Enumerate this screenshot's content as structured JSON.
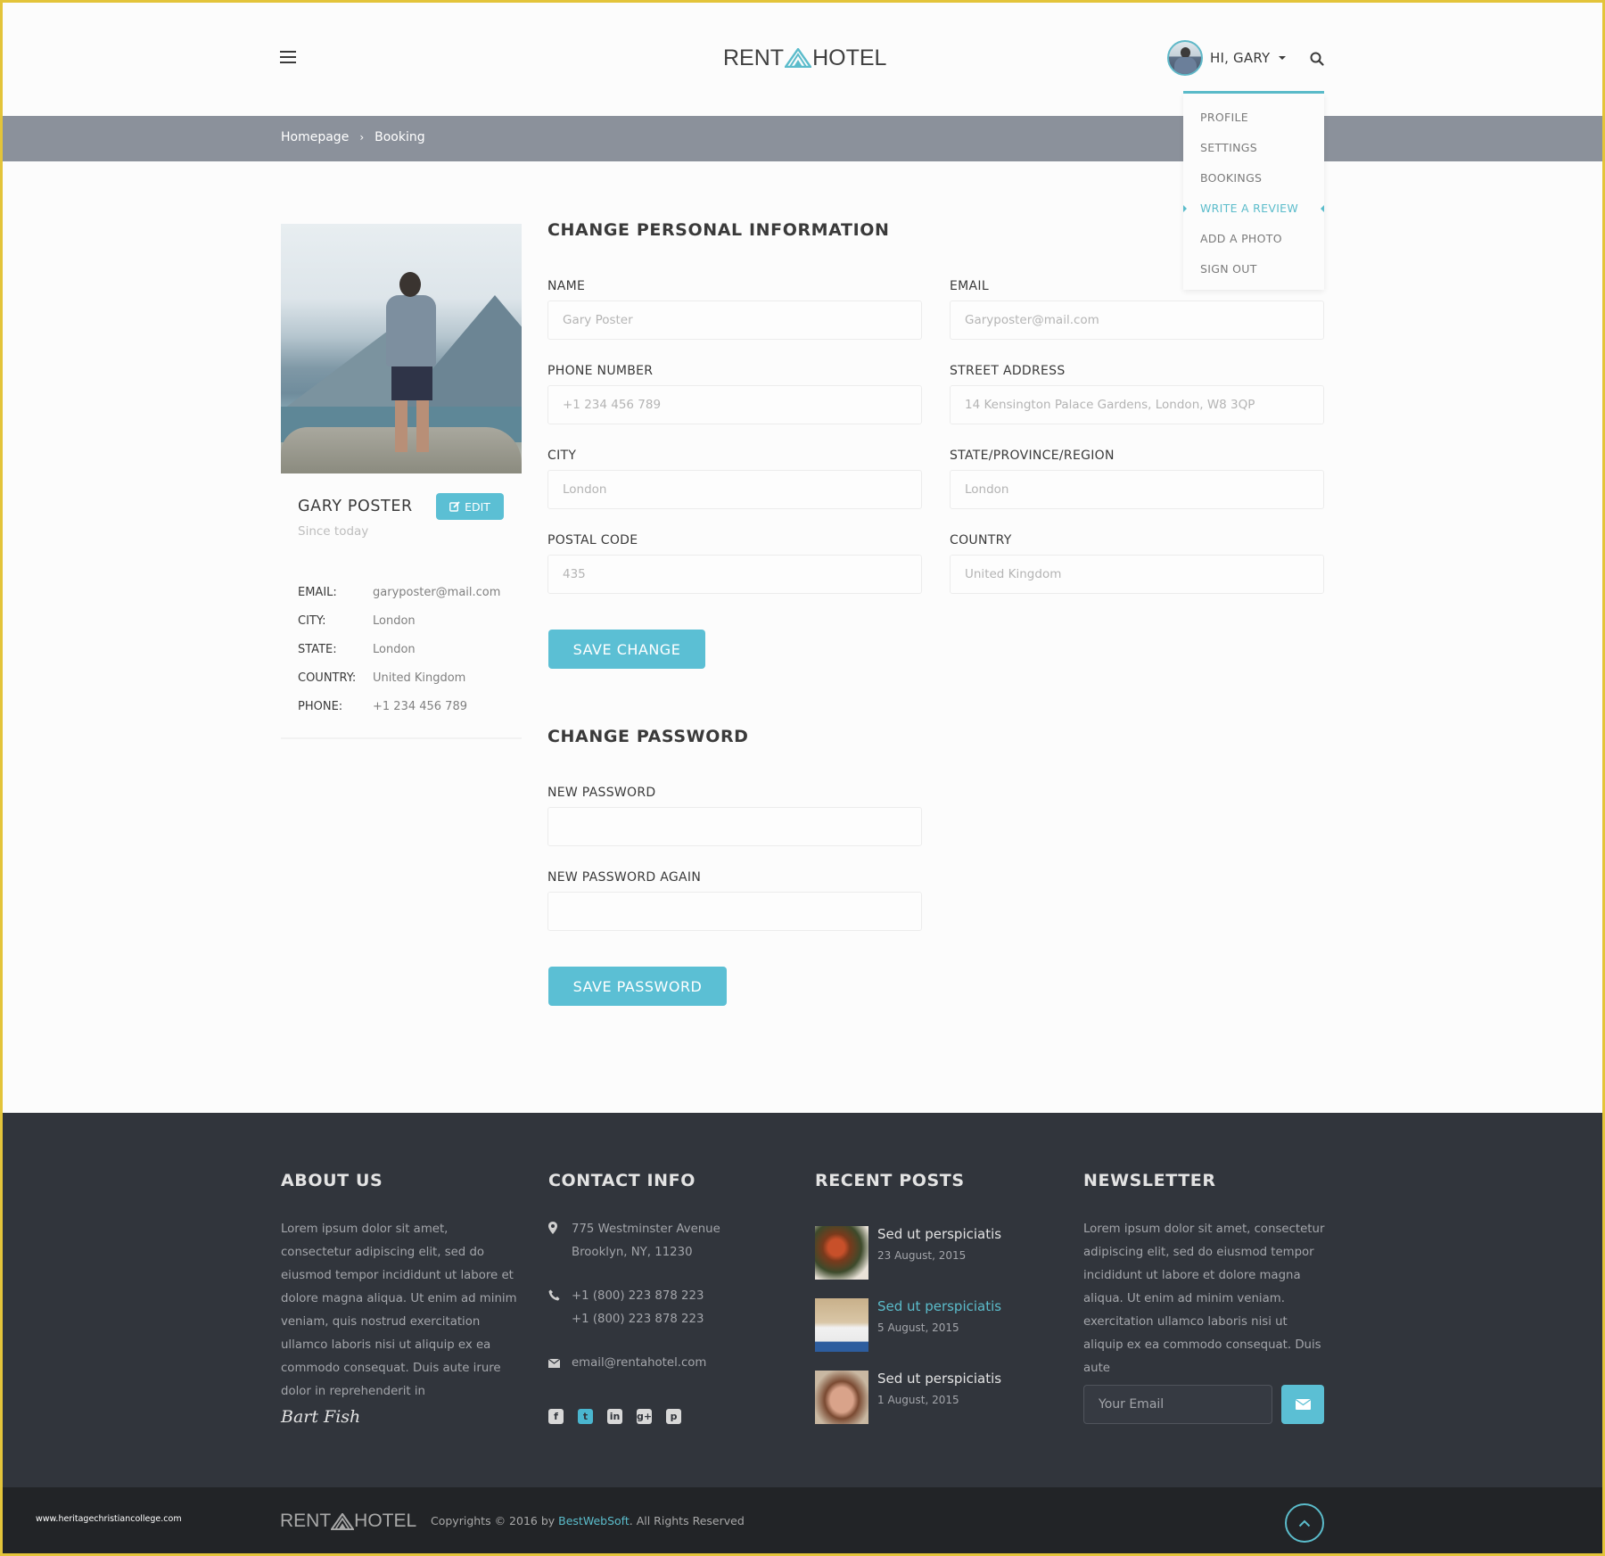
{
  "header": {
    "logo_left": "RENT",
    "logo_right": "HOTEL",
    "greeting": "HI, GARY",
    "icons": {
      "menu": "hamburger-icon",
      "search": "search-icon",
      "caret": "caret-down-icon"
    }
  },
  "user_dropdown": {
    "items": [
      {
        "label": "PROFILE",
        "active": false
      },
      {
        "label": "SETTINGS",
        "active": false
      },
      {
        "label": "BOOKINGS",
        "active": false
      },
      {
        "label": "WRITE A REVIEW",
        "active": true
      },
      {
        "label": "ADD A PHOTO",
        "active": false
      },
      {
        "label": "SIGN OUT",
        "active": false
      }
    ]
  },
  "breadcrumb": {
    "items": [
      "Homepage",
      "Booking"
    ],
    "separator": "›"
  },
  "profile": {
    "name": "GARY POSTER",
    "edit_label": "EDIT",
    "since": "Since today",
    "details": [
      {
        "key": "EMAIL:",
        "value": "garyposter@mail.com"
      },
      {
        "key": "CITY:",
        "value": "London"
      },
      {
        "key": "STATE:",
        "value": "London"
      },
      {
        "key": "COUNTRY:",
        "value": "United Kingdom"
      },
      {
        "key": "PHONE:",
        "value": "+1 234 456 789"
      }
    ]
  },
  "personal_form": {
    "title": "CHANGE PERSONAL INFORMATION",
    "fields": {
      "name": {
        "label": "NAME",
        "placeholder": "Gary Poster"
      },
      "email": {
        "label": "EMAIL",
        "placeholder": "Garyposter@mail.com"
      },
      "phone": {
        "label": "PHONE NUMBER",
        "placeholder": "+1 234 456 789"
      },
      "street": {
        "label": "STREET ADDRESS",
        "placeholder": "14 Kensington Palace Gardens, London, W8 3QP"
      },
      "city": {
        "label": "CITY",
        "placeholder": "London"
      },
      "state": {
        "label": "STATE/PROVINCE/REGION",
        "placeholder": "London"
      },
      "postal": {
        "label": "POSTAL CODE",
        "placeholder": "435"
      },
      "country": {
        "label": "COUNTRY",
        "placeholder": "United Kingdom"
      }
    },
    "save_label": "SAVE CHANGE"
  },
  "password_form": {
    "title": "CHANGE PASSWORD",
    "new_label": "NEW PASSWORD",
    "again_label": "NEW PASSWORD AGAIN",
    "new_value": "",
    "again_value": "",
    "save_label": "SAVE PASSWORD"
  },
  "footer": {
    "about": {
      "title": "ABOUT US",
      "text": "Lorem ipsum dolor sit amet, consectetur adipiscing elit, sed do eiusmod tempor incididunt ut labore et dolore magna aliqua. Ut enim ad minim veniam, quis nostrud exercitation ullamco laboris nisi ut aliquip ex ea commodo consequat. Duis aute irure dolor in reprehenderit in",
      "signature": "Bart Fish"
    },
    "contact": {
      "title": "CONTACT INFO",
      "address": [
        "775 Westminster Avenue",
        "Brooklyn, NY, 11230"
      ],
      "phones": [
        "+1 (800) 223 878 223",
        "+1 (800) 223 878 223"
      ],
      "email": "email@rentahotel.com",
      "socials": [
        "facebook-icon",
        "twitter-icon",
        "linkedin-icon",
        "google-plus-icon",
        "pinterest-icon"
      ]
    },
    "recent_posts": {
      "title": "RECENT POSTS",
      "posts": [
        {
          "title": "Sed ut perspiciatis",
          "date": "23 August, 2015",
          "highlighted": false
        },
        {
          "title": "Sed ut perspiciatis",
          "date": "5 August, 2015",
          "highlighted": true
        },
        {
          "title": "Sed ut perspiciatis",
          "date": "1 August, 2015",
          "highlighted": false
        }
      ]
    },
    "newsletter": {
      "title": "NEWSLETTER",
      "text": "Lorem ipsum dolor sit amet, consectetur adipiscing elit, sed do eiusmod tempor incididunt ut labore et dolore magna aliqua. Ut enim ad minim veniam. exercitation ullamco laboris nisi ut aliquip ex ea commodo consequat. Duis aute",
      "email_placeholder": "Your Email"
    }
  },
  "bottom_bar": {
    "watermark": "www.heritagechristiancollege.com",
    "logo_left": "RENT",
    "logo_right": "HOTEL",
    "copyright_prefix": "Copyrights © 2016 by ",
    "copyright_brand": "BestWebSoft",
    "copyright_suffix": ". All Rights Reserved"
  },
  "colors": {
    "accent": "#5bbfd4",
    "breadcrumb_bg": "#8b919b",
    "footer_bg": "#31353c",
    "bottom_bg": "#222427",
    "frame": "#e3c43a"
  }
}
